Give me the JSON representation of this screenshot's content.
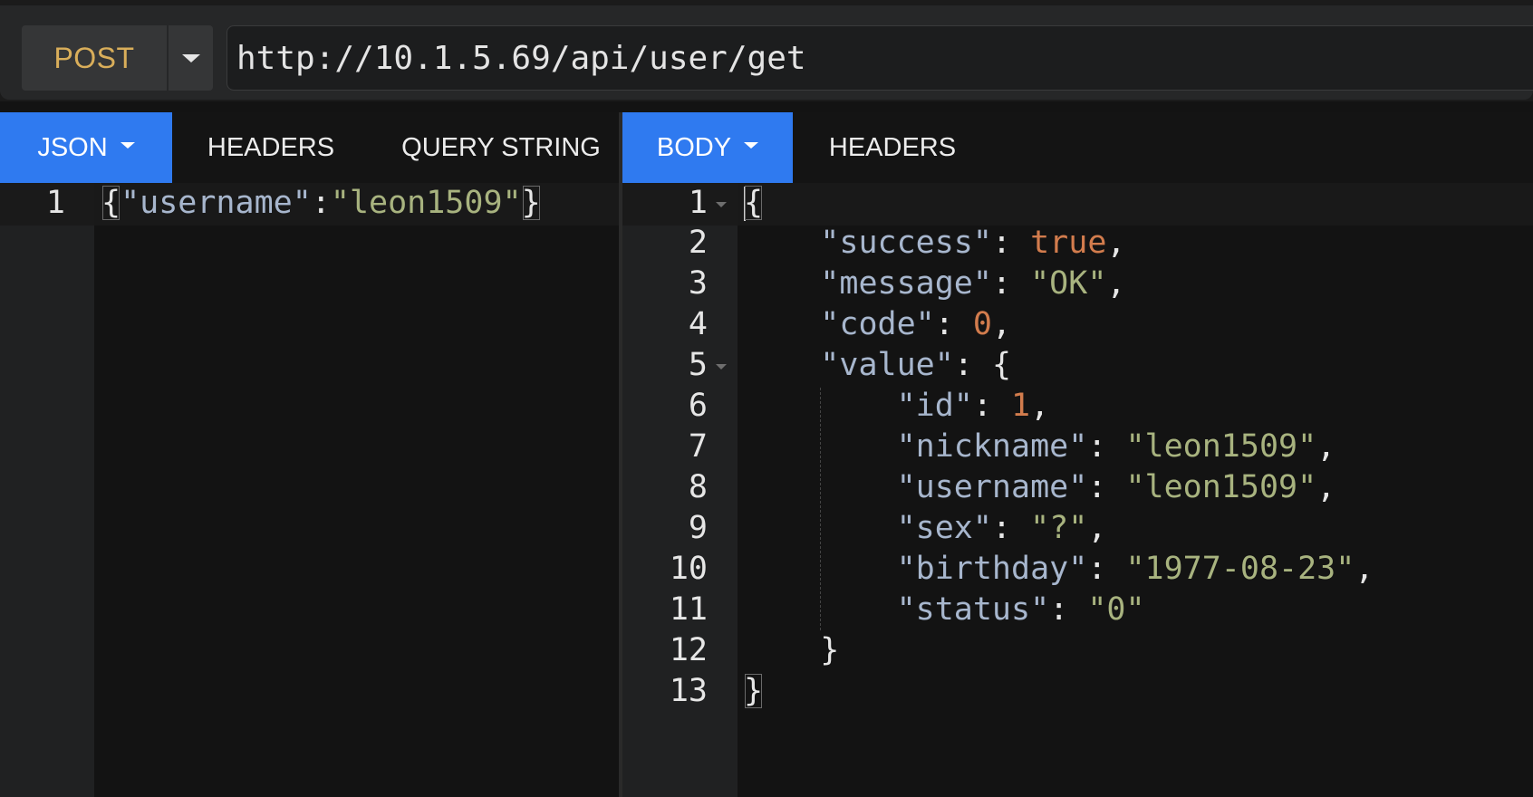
{
  "request": {
    "method": "POST",
    "url": "http://10.1.5.69/api/user/get"
  },
  "left_pane": {
    "tabs": [
      {
        "label": "JSON",
        "active": true,
        "has_dropdown": true
      },
      {
        "label": "HEADERS",
        "active": false
      },
      {
        "label": "QUERY STRING",
        "active": false
      }
    ],
    "line_numbers": [
      "1"
    ],
    "lines": [
      "{\"username\":\"leon1509\"}"
    ]
  },
  "right_pane": {
    "tabs": [
      {
        "label": "BODY",
        "active": true,
        "has_dropdown": true
      },
      {
        "label": "HEADERS",
        "active": false
      }
    ],
    "line_numbers": [
      "1",
      "2",
      "3",
      "4",
      "5",
      "6",
      "7",
      "8",
      "9",
      "10",
      "11",
      "12",
      "13"
    ],
    "response_lines": [
      "{",
      "    \"success\": true,",
      "    \"message\": \"OK\",",
      "    \"code\": 0,",
      "    \"value\": {",
      "        \"id\": 1,",
      "        \"nickname\": \"leon1509\",",
      "        \"username\": \"leon1509\",",
      "        \"sex\": \"?\",",
      "        \"birthday\": \"1977-08-23\",",
      "        \"status\": \"0\"",
      "    }",
      "}"
    ]
  },
  "colors": {
    "accent_tab": "#2f7af0",
    "method_text": "#d9ae5a",
    "json_key": "#a7b6cd",
    "json_string": "#a8b37f",
    "json_literal": "#d27c4d"
  },
  "icons": {
    "method_dropdown": "chevron-down-icon",
    "tab_dropdown": "caret-down-icon",
    "fold": "fold-arrow-icon"
  }
}
